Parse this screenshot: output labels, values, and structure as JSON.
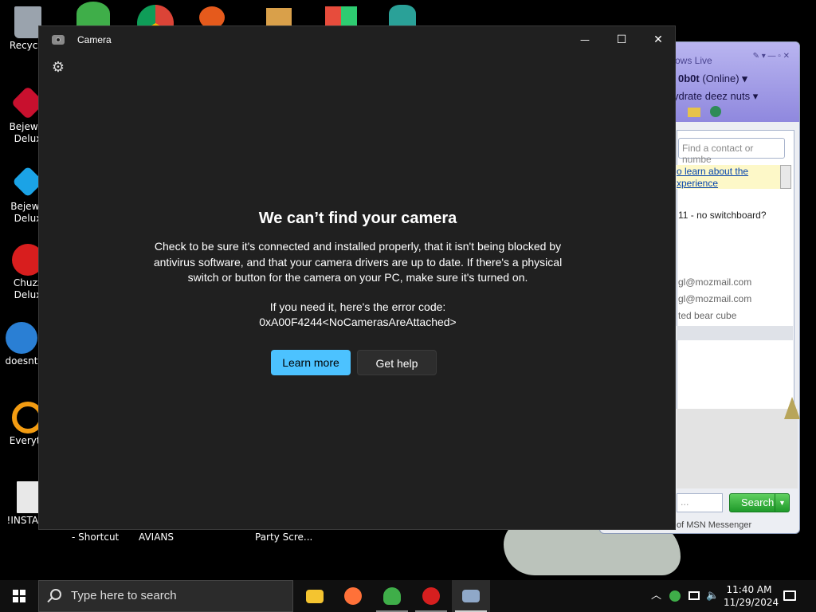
{
  "desktop": {
    "icons": [
      {
        "label": "Recycle",
        "color": "#9aa3ad"
      },
      {
        "label": "Bejewel\nDelux",
        "color": "#c8102e"
      },
      {
        "label": "Bejewe\nDelux",
        "color": "#1ba3e6"
      },
      {
        "label": "Chuzz\nDelux",
        "color": "#d81e1e"
      },
      {
        "label": "doesnt",
        "color": "#2a7fd4"
      },
      {
        "label": "Everyth",
        "color": "#f39c12"
      },
      {
        "label": "!INSTALL",
        "color": "#e8e8e8"
      }
    ],
    "bottom_labels": [
      "- Shortcut",
      "AVIANS",
      "Party Scre..."
    ]
  },
  "msn": {
    "window_title": "ows Live",
    "status_name": "0b0t",
    "status_text": "(Online)",
    "personal_message": "ydrate deez nuts",
    "find_placeholder": "Find a contact or numbe",
    "note_line1": "o learn about the",
    "note_line2": "xperience",
    "contacts": [
      "11 - no switchboard?",
      "gl@mozmail.com",
      "gl@mozmail.com",
      "ted bear cube"
    ],
    "search_field": "...",
    "search_label": "Search",
    "footer": "of MSN Messenger"
  },
  "camera": {
    "title": "Camera",
    "heading": "We can’t find your camera",
    "message": "Check to be sure it's connected and installed properly, that it isn't being blocked by antivirus software, and that your camera drivers are up to date. If there's a physical switch or button for the camera on your PC, make sure it's turned on.",
    "error_intro": "If you need it, here's the error code:",
    "error_code": "0xA00F4244<NoCamerasAreAttached>",
    "learn_more": "Learn more",
    "get_help": "Get help",
    "controls": {
      "minimize": "—",
      "maximize": "☐",
      "close": "✕"
    },
    "settings_icon": "⚙"
  },
  "taskbar": {
    "search_placeholder": "Type here to search",
    "time": "11:40 AM",
    "date": "11/29/2024",
    "apps": [
      {
        "name": "file-explorer",
        "color": "#f4c430"
      },
      {
        "name": "firefox",
        "color": "#ff7139"
      },
      {
        "name": "msn-messenger",
        "color": "#3fae49"
      },
      {
        "name": "radiation-app",
        "color": "#d61f1f"
      },
      {
        "name": "camera",
        "color": "#8fa8c8"
      }
    ],
    "accent": "#4cc2ff"
  }
}
